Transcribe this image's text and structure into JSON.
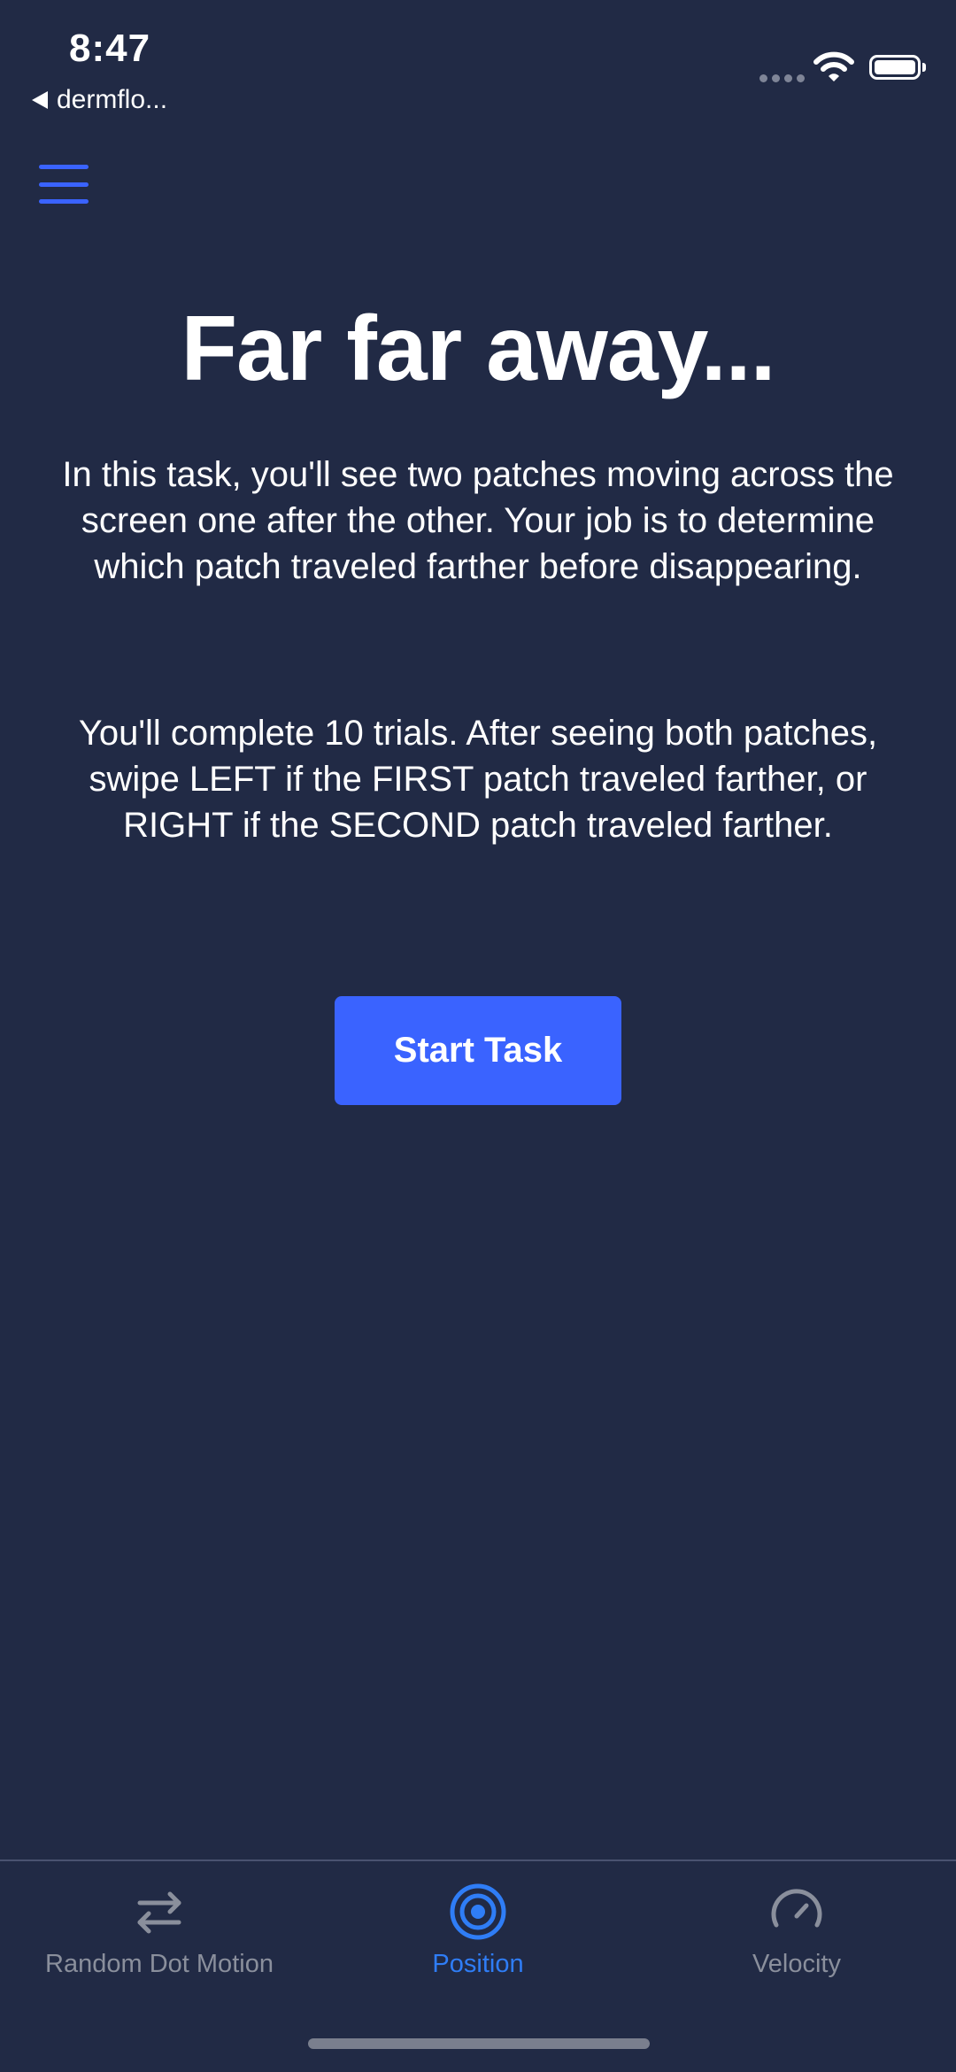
{
  "status_bar": {
    "time": "8:47",
    "back_app": "dermflo..."
  },
  "header": {
    "menu_icon": "hamburger-menu-icon"
  },
  "main": {
    "title": "Far far away...",
    "paragraph_1": "In this task, you'll see two patches moving across the screen one after the other. Your job is to determine which patch traveled farther before disappearing.",
    "paragraph_2": "You'll complete 10 trials. After seeing both patches, swipe LEFT if the FIRST patch traveled farther, or RIGHT if the SECOND patch traveled farther.",
    "start_button_label": "Start Task"
  },
  "tab_bar": {
    "tabs": [
      {
        "label": "Random Dot Motion",
        "icon": "swap-arrows-icon",
        "active": false
      },
      {
        "label": "Position",
        "icon": "target-icon",
        "active": true
      },
      {
        "label": "Velocity",
        "icon": "speedometer-icon",
        "active": false
      }
    ]
  },
  "colors": {
    "background": "#212a45",
    "accent": "#3a63ff",
    "active_tab": "#2f7df6",
    "inactive_tab": "#8a8f9c",
    "text": "#ffffff"
  }
}
